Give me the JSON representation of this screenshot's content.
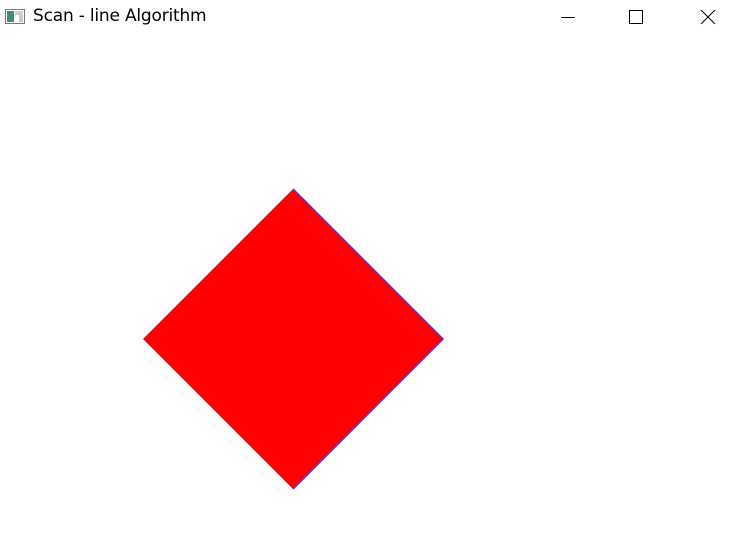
{
  "window": {
    "title": "Scan - line Algorithm"
  },
  "icons": {
    "app": "app-window-icon",
    "minimize": "minimize-icon",
    "maximize": "maximize-icon",
    "close": "close-icon"
  },
  "colors": {
    "fill": "#ff0000",
    "edge": "#5a2fd6",
    "background": "#ffffff"
  }
}
